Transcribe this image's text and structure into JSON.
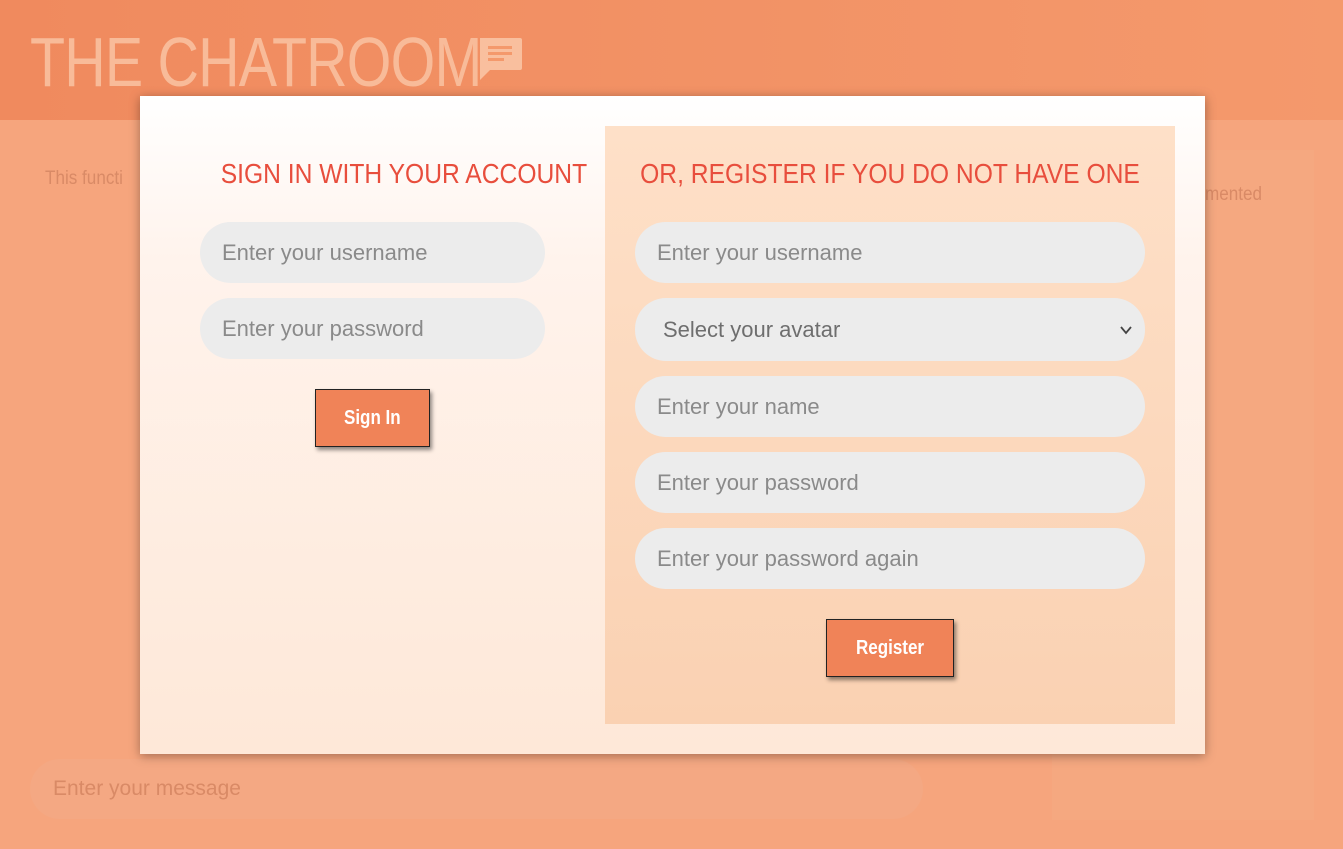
{
  "app": {
    "title": "THE CHATROOM",
    "icon": "chat-bubble-icon"
  },
  "background": {
    "info_left": "This functi",
    "info_right": "mented",
    "message_placeholder": "Enter your message"
  },
  "signin": {
    "title": "SIGN IN WITH YOUR ACCOUNT",
    "username_placeholder": "Enter your username",
    "password_placeholder": "Enter your password",
    "button_label": "Sign In"
  },
  "register": {
    "title": "OR, REGISTER IF YOU DO NOT HAVE ONE",
    "username_placeholder": "Enter your username",
    "avatar_select": "Select your avatar",
    "name_placeholder": "Enter your name",
    "password_placeholder": "Enter your password",
    "password_again_placeholder": "Enter your password again",
    "button_label": "Register"
  },
  "colors": {
    "accent": "#f08358",
    "title_red": "#e84e3d",
    "header": "#f08a5e",
    "field_bg": "#ececec"
  }
}
